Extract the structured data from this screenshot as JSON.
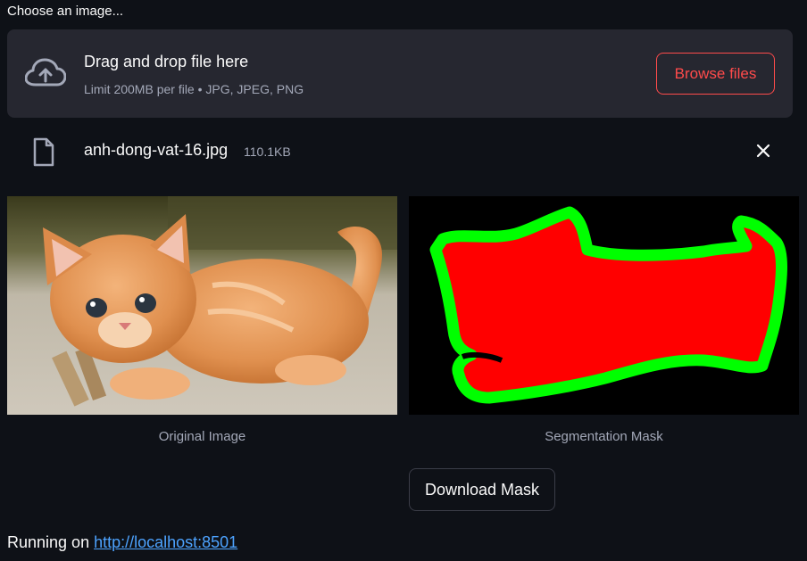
{
  "uploader": {
    "label": "Choose an image...",
    "drop_title": "Drag and drop file here",
    "drop_subtitle": "Limit 200MB per file • JPG, JPEG, PNG",
    "browse_label": "Browse files",
    "upload_icon": "cloud-upload-icon"
  },
  "file": {
    "name": "anh-dong-vat-16.jpg",
    "size": "110.1KB",
    "file_icon": "file-icon",
    "remove_icon": "close-icon"
  },
  "images": {
    "original_caption": "Original Image",
    "mask_caption": "Segmentation Mask"
  },
  "actions": {
    "download_label": "Download Mask"
  },
  "footer": {
    "prefix": "Running on ",
    "link": "http://localhost:8501"
  },
  "colors": {
    "accent": "#ff4b4b",
    "background": "#0e1117",
    "surface": "#262730",
    "link": "#4da3ff",
    "mask_fill": "#ff0000",
    "mask_outline": "#00ff00"
  }
}
